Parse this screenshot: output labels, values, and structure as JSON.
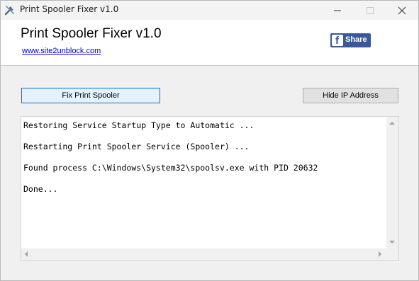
{
  "window": {
    "title": "Print Spooler Fixer v1.0",
    "icon": "wrench-icon"
  },
  "header": {
    "app_title": "Print Spooler Fixer v1.0",
    "site_link": "www.site2unblock.com",
    "share_label": "Share",
    "share_icon": "facebook-icon",
    "share_color": "#3b5998"
  },
  "toolbar": {
    "fix_label": "Fix Print Spooler",
    "hide_ip_label": "Hide IP Address"
  },
  "log": {
    "lines": [
      "Restoring Service Startup Type to Automatic ...",
      "Restarting Print Spooler Service (Spooler) ...",
      "Found process C:\\Windows\\System32\\spoolsv.exe with PID 20632",
      "Done..."
    ]
  },
  "colors": {
    "accent": "#0078d7",
    "link": "#0000cc"
  }
}
